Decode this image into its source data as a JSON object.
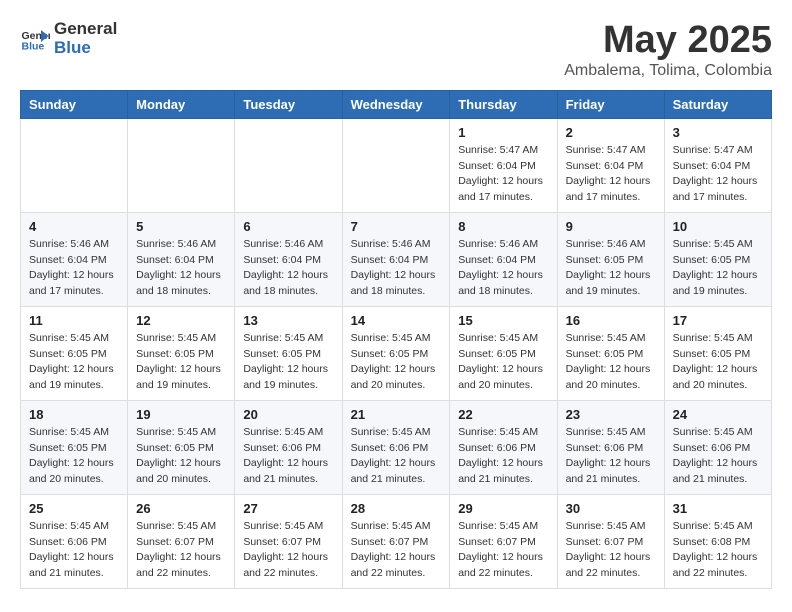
{
  "header": {
    "logo_general": "General",
    "logo_blue": "Blue",
    "month_title": "May 2025",
    "location": "Ambalema, Tolima, Colombia"
  },
  "days_of_week": [
    "Sunday",
    "Monday",
    "Tuesday",
    "Wednesday",
    "Thursday",
    "Friday",
    "Saturday"
  ],
  "weeks": [
    [
      {
        "day": "",
        "info": ""
      },
      {
        "day": "",
        "info": ""
      },
      {
        "day": "",
        "info": ""
      },
      {
        "day": "",
        "info": ""
      },
      {
        "day": "1",
        "info": "Sunrise: 5:47 AM\nSunset: 6:04 PM\nDaylight: 12 hours\nand 17 minutes."
      },
      {
        "day": "2",
        "info": "Sunrise: 5:47 AM\nSunset: 6:04 PM\nDaylight: 12 hours\nand 17 minutes."
      },
      {
        "day": "3",
        "info": "Sunrise: 5:47 AM\nSunset: 6:04 PM\nDaylight: 12 hours\nand 17 minutes."
      }
    ],
    [
      {
        "day": "4",
        "info": "Sunrise: 5:46 AM\nSunset: 6:04 PM\nDaylight: 12 hours\nand 17 minutes."
      },
      {
        "day": "5",
        "info": "Sunrise: 5:46 AM\nSunset: 6:04 PM\nDaylight: 12 hours\nand 18 minutes."
      },
      {
        "day": "6",
        "info": "Sunrise: 5:46 AM\nSunset: 6:04 PM\nDaylight: 12 hours\nand 18 minutes."
      },
      {
        "day": "7",
        "info": "Sunrise: 5:46 AM\nSunset: 6:04 PM\nDaylight: 12 hours\nand 18 minutes."
      },
      {
        "day": "8",
        "info": "Sunrise: 5:46 AM\nSunset: 6:04 PM\nDaylight: 12 hours\nand 18 minutes."
      },
      {
        "day": "9",
        "info": "Sunrise: 5:46 AM\nSunset: 6:05 PM\nDaylight: 12 hours\nand 19 minutes."
      },
      {
        "day": "10",
        "info": "Sunrise: 5:45 AM\nSunset: 6:05 PM\nDaylight: 12 hours\nand 19 minutes."
      }
    ],
    [
      {
        "day": "11",
        "info": "Sunrise: 5:45 AM\nSunset: 6:05 PM\nDaylight: 12 hours\nand 19 minutes."
      },
      {
        "day": "12",
        "info": "Sunrise: 5:45 AM\nSunset: 6:05 PM\nDaylight: 12 hours\nand 19 minutes."
      },
      {
        "day": "13",
        "info": "Sunrise: 5:45 AM\nSunset: 6:05 PM\nDaylight: 12 hours\nand 19 minutes."
      },
      {
        "day": "14",
        "info": "Sunrise: 5:45 AM\nSunset: 6:05 PM\nDaylight: 12 hours\nand 20 minutes."
      },
      {
        "day": "15",
        "info": "Sunrise: 5:45 AM\nSunset: 6:05 PM\nDaylight: 12 hours\nand 20 minutes."
      },
      {
        "day": "16",
        "info": "Sunrise: 5:45 AM\nSunset: 6:05 PM\nDaylight: 12 hours\nand 20 minutes."
      },
      {
        "day": "17",
        "info": "Sunrise: 5:45 AM\nSunset: 6:05 PM\nDaylight: 12 hours\nand 20 minutes."
      }
    ],
    [
      {
        "day": "18",
        "info": "Sunrise: 5:45 AM\nSunset: 6:05 PM\nDaylight: 12 hours\nand 20 minutes."
      },
      {
        "day": "19",
        "info": "Sunrise: 5:45 AM\nSunset: 6:05 PM\nDaylight: 12 hours\nand 20 minutes."
      },
      {
        "day": "20",
        "info": "Sunrise: 5:45 AM\nSunset: 6:06 PM\nDaylight: 12 hours\nand 21 minutes."
      },
      {
        "day": "21",
        "info": "Sunrise: 5:45 AM\nSunset: 6:06 PM\nDaylight: 12 hours\nand 21 minutes."
      },
      {
        "day": "22",
        "info": "Sunrise: 5:45 AM\nSunset: 6:06 PM\nDaylight: 12 hours\nand 21 minutes."
      },
      {
        "day": "23",
        "info": "Sunrise: 5:45 AM\nSunset: 6:06 PM\nDaylight: 12 hours\nand 21 minutes."
      },
      {
        "day": "24",
        "info": "Sunrise: 5:45 AM\nSunset: 6:06 PM\nDaylight: 12 hours\nand 21 minutes."
      }
    ],
    [
      {
        "day": "25",
        "info": "Sunrise: 5:45 AM\nSunset: 6:06 PM\nDaylight: 12 hours\nand 21 minutes."
      },
      {
        "day": "26",
        "info": "Sunrise: 5:45 AM\nSunset: 6:07 PM\nDaylight: 12 hours\nand 22 minutes."
      },
      {
        "day": "27",
        "info": "Sunrise: 5:45 AM\nSunset: 6:07 PM\nDaylight: 12 hours\nand 22 minutes."
      },
      {
        "day": "28",
        "info": "Sunrise: 5:45 AM\nSunset: 6:07 PM\nDaylight: 12 hours\nand 22 minutes."
      },
      {
        "day": "29",
        "info": "Sunrise: 5:45 AM\nSunset: 6:07 PM\nDaylight: 12 hours\nand 22 minutes."
      },
      {
        "day": "30",
        "info": "Sunrise: 5:45 AM\nSunset: 6:07 PM\nDaylight: 12 hours\nand 22 minutes."
      },
      {
        "day": "31",
        "info": "Sunrise: 5:45 AM\nSunset: 6:08 PM\nDaylight: 12 hours\nand 22 minutes."
      }
    ]
  ]
}
